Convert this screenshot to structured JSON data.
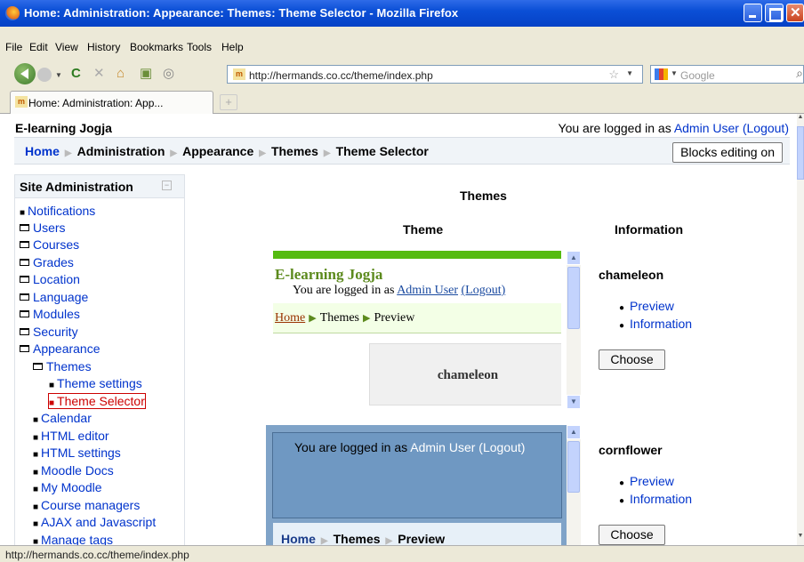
{
  "window": {
    "title": "Home: Administration: Appearance: Themes: Theme Selector - Mozilla Firefox"
  },
  "menu": [
    "File",
    "Edit",
    "View",
    "History",
    "Bookmarks",
    "Tools",
    "Help"
  ],
  "toolbar": {
    "url": "http://hermands.co.cc/theme/index.php",
    "search_placeholder": "Google"
  },
  "tab": {
    "label": "Home: Administration: App..."
  },
  "header": {
    "site_name": "E-learning Jogja",
    "login_prefix": "You are logged in as ",
    "user": "Admin User",
    "logout": "(Logout)"
  },
  "breadcrumb": [
    "Home",
    "Administration",
    "Appearance",
    "Themes",
    "Theme Selector"
  ],
  "blocks_button": "Blocks editing on",
  "sidebar": {
    "title": "Site Administration",
    "items": [
      {
        "label": "Notifications",
        "kind": "bullet"
      },
      {
        "label": "Users",
        "kind": "folder"
      },
      {
        "label": "Courses",
        "kind": "folder"
      },
      {
        "label": "Grades",
        "kind": "folder"
      },
      {
        "label": "Location",
        "kind": "folder"
      },
      {
        "label": "Language",
        "kind": "folder"
      },
      {
        "label": "Modules",
        "kind": "folder"
      },
      {
        "label": "Security",
        "kind": "folder"
      },
      {
        "label": "Appearance",
        "kind": "folder-open"
      },
      {
        "label": "Themes",
        "kind": "folder-open"
      },
      {
        "label": "Theme settings",
        "kind": "bullet"
      },
      {
        "label": "Theme Selector",
        "kind": "bullet",
        "current": true
      },
      {
        "label": "Calendar",
        "kind": "bullet"
      },
      {
        "label": "HTML editor",
        "kind": "bullet"
      },
      {
        "label": "HTML settings",
        "kind": "bullet"
      },
      {
        "label": "Moodle Docs",
        "kind": "bullet"
      },
      {
        "label": "My Moodle",
        "kind": "bullet"
      },
      {
        "label": "Course managers",
        "kind": "bullet"
      },
      {
        "label": "AJAX and Javascript",
        "kind": "bullet"
      },
      {
        "label": "Manage tags",
        "kind": "bullet"
      }
    ]
  },
  "main": {
    "heading": "Themes",
    "col_theme": "Theme",
    "col_info": "Information",
    "themes": [
      {
        "name": "chameleon",
        "preview": {
          "site_name": "E-learning Jogja",
          "login_prefix": "You are logged in as ",
          "user": "Admin User",
          "logout": "(Logout)",
          "crumbs": [
            "Home",
            "Themes",
            "Preview"
          ],
          "label": "chameleon"
        },
        "links": [
          "Preview",
          "Information"
        ],
        "choose": "Choose"
      },
      {
        "name": "cornflower",
        "preview": {
          "login_prefix": "You are logged in as ",
          "user": "Admin User",
          "logout": "(Logout)",
          "crumbs": [
            "Home",
            "Themes",
            "Preview"
          ]
        },
        "links": [
          "Preview",
          "Information"
        ],
        "choose": "Choose"
      }
    ]
  },
  "status": "http://hermands.co.cc/theme/index.php",
  "colors": {
    "link": "#0033cc",
    "current": "#cc0000",
    "chameleon_green": "#55bb11",
    "cornflower_blue": "#7fa3c8"
  }
}
